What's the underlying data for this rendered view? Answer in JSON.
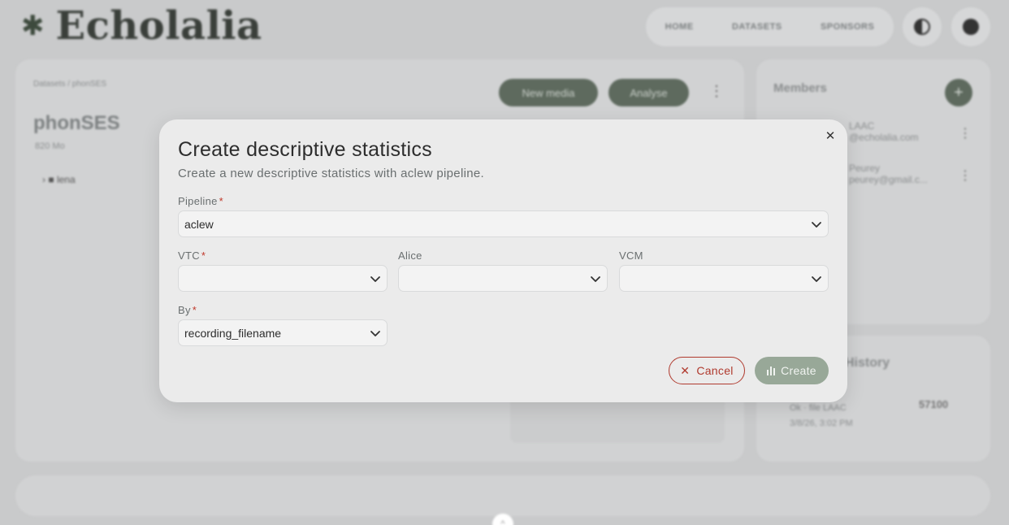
{
  "app": {
    "brand": "Echolalia"
  },
  "topnav": {
    "home": "HOME",
    "datasets": "DATASETS",
    "sponsors": "SPONSORS"
  },
  "background": {
    "breadcrumb": "Datasets / phonSES",
    "project_title": "phonSES",
    "project_size": "820 Mo",
    "tree_item": "lena",
    "new_media_label": "New media",
    "analyse_label": "Analyse",
    "members_title": "Members",
    "members": [
      {
        "name": "LAAC",
        "email": "@echolalia.com"
      },
      {
        "name": "Peurey",
        "email": "peurey@gmail.c..."
      }
    ],
    "history_title": "History",
    "history_entry": {
      "line1": "Ok · file LAAC",
      "line2": "3/8/26, 3:02 PM",
      "size": "57100"
    }
  },
  "modal": {
    "title": "Create descriptive statistics",
    "subtitle": "Create a new descriptive statistics with aclew pipeline.",
    "required_mark": "*",
    "fields": {
      "pipeline": {
        "label": "Pipeline",
        "value": "aclew",
        "required": true
      },
      "vtc": {
        "label": "VTC",
        "value": "",
        "required": true
      },
      "alice": {
        "label": "Alice",
        "value": "",
        "required": false
      },
      "vcm": {
        "label": "VCM",
        "value": "",
        "required": false
      },
      "by": {
        "label": "By",
        "value": "recording_filename",
        "required": true
      }
    },
    "cancel_label": "Cancel",
    "create_label": "Create"
  },
  "colors": {
    "accent": "#98a898",
    "danger": "#b03a2e",
    "brand_dark": "#5e6a5e"
  }
}
